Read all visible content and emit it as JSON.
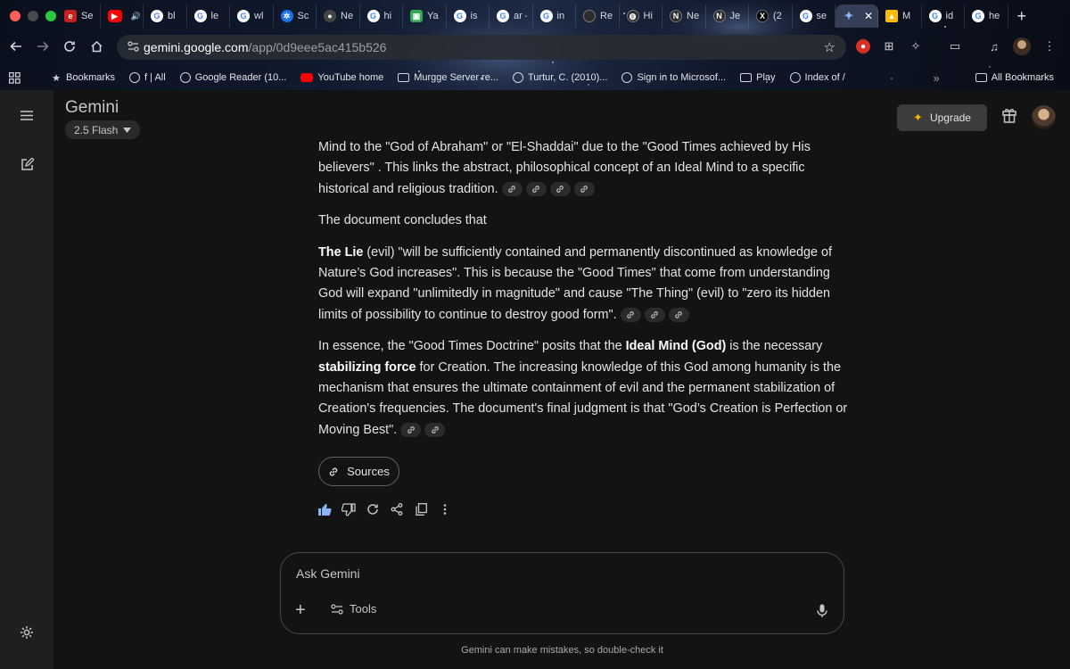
{
  "browser": {
    "tabs": [
      {
        "favicon": "e-red-icon",
        "label": "Se"
      },
      {
        "favicon": "youtube-icon",
        "label": ""
      },
      {
        "favicon": "google-icon",
        "label": "bl"
      },
      {
        "favicon": "google-icon",
        "label": "le"
      },
      {
        "favicon": "google-icon",
        "label": "wl"
      },
      {
        "favicon": "gear-icon",
        "label": "Sc"
      },
      {
        "favicon": "github-icon",
        "label": "Ne"
      },
      {
        "favicon": "google-icon",
        "label": "hi"
      },
      {
        "favicon": "green-icon",
        "label": "Ya"
      },
      {
        "favicon": "google-icon",
        "label": "is"
      },
      {
        "favicon": "google-icon",
        "label": "ar"
      },
      {
        "favicon": "google-icon",
        "label": "in"
      },
      {
        "favicon": "dark-icon",
        "label": "Re"
      },
      {
        "favicon": "globe-icon",
        "label": "Hi"
      },
      {
        "favicon": "notion-icon",
        "label": "Ne"
      },
      {
        "favicon": "notion-icon",
        "label": "Je"
      },
      {
        "favicon": "x-icon",
        "label": "(2"
      },
      {
        "favicon": "google-icon",
        "label": "se"
      },
      {
        "favicon": "gemini-star-icon",
        "label": "",
        "active": true
      },
      {
        "favicon": "drive-icon",
        "label": "M"
      },
      {
        "favicon": "google-icon",
        "label": "id"
      },
      {
        "favicon": "google-icon",
        "label": "he"
      }
    ],
    "address": {
      "host": "gemini.google.com",
      "path": "/app/0d9eee5ac415b526"
    },
    "bookmarks": [
      {
        "icon": "star-icon",
        "label": "Bookmarks"
      },
      {
        "icon": "globe-icon",
        "label": "f | All"
      },
      {
        "icon": "globe-icon",
        "label": "Google Reader (10..."
      },
      {
        "icon": "youtube-icon",
        "label": "YouTube home"
      },
      {
        "icon": "folder-icon",
        "label": "Murgge Server re..."
      },
      {
        "icon": "globe-icon",
        "label": "Turtur, C. (2010)..."
      },
      {
        "icon": "globe-icon",
        "label": "Sign in to Microsof..."
      },
      {
        "icon": "folder-icon",
        "label": "Play"
      },
      {
        "icon": "globe-icon",
        "label": "Index of /"
      }
    ],
    "all_bookmarks": "All Bookmarks",
    "overflow": "»"
  },
  "app": {
    "title": "Gemini",
    "model": "2.5 Flash",
    "upgrade_label": "Upgrade",
    "paragraphs": [
      {
        "segments": [
          {
            "t": "Mind to the \"God of Abraham\" or \"El-Shaddai\" due to the \"Good Times achieved by His believers\" . This links the abstract, philosophical concept of an Ideal Mind to a specific historical and religious tradition."
          }
        ],
        "chips": 4
      },
      {
        "segments": [
          {
            "t": "The document concludes that"
          }
        ],
        "chips": 0
      },
      {
        "segments": [
          {
            "t": "The Lie",
            "b": true
          },
          {
            "t": " (evil) \"will be sufficiently contained and permanently discontinued as knowledge of Nature’s God increases\". This is because the \"Good Times\" that come from understanding God will expand \"unlimitedly in magnitude\" and cause \"The Thing\" (evil) to \"zero its hidden limits of possibility to continue to destroy good form\"."
          }
        ],
        "chips": 3
      },
      {
        "segments": [
          {
            "t": "In essence, the \"Good Times Doctrine\" posits that the "
          },
          {
            "t": "Ideal Mind (God)",
            "b": true
          },
          {
            "t": " is the necessary "
          },
          {
            "t": "stabilizing force",
            "b": true
          },
          {
            "t": " for Creation. The increasing knowledge of this God among humanity is the mechanism that ensures the ultimate containment of evil and the permanent stabilization of Creation's frequencies. The document's final judgment is that \"God’s Creation is Perfection or Moving Best\"."
          }
        ],
        "chips": 2
      }
    ],
    "sources_label": "Sources",
    "input": {
      "placeholder": "Ask Gemini",
      "tools_label": "Tools"
    },
    "disclaimer": "Gemini can make mistakes, so double-check it",
    "colors": {
      "background": "#131314",
      "sidebar": "#1e1f20",
      "text": "#e3e3e3",
      "upgrade_bg": "#3c3c3c"
    }
  }
}
